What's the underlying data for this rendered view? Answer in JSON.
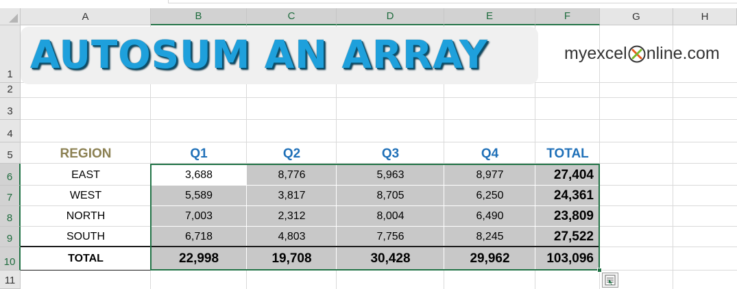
{
  "columns": [
    "A",
    "B",
    "C",
    "D",
    "E",
    "F",
    "G",
    "H"
  ],
  "rows": [
    "1",
    "2",
    "3",
    "4",
    "5",
    "6",
    "7",
    "8",
    "9",
    "10",
    "11"
  ],
  "title": "AUTOSUM AN ARRAY",
  "logo": {
    "prefix": "myexcel",
    "suffix": "nline.com"
  },
  "headers": {
    "region": "REGION",
    "q1": "Q1",
    "q2": "Q2",
    "q3": "Q3",
    "q4": "Q4",
    "total": "TOTAL"
  },
  "table": [
    {
      "region": "EAST",
      "q1": "3,688",
      "q2": "8,776",
      "q3": "5,963",
      "q4": "8,977",
      "total": "27,404"
    },
    {
      "region": "WEST",
      "q1": "5,589",
      "q2": "3,817",
      "q3": "8,705",
      "q4": "6,250",
      "total": "24,361"
    },
    {
      "region": "NORTH",
      "q1": "7,003",
      "q2": "2,312",
      "q3": "8,004",
      "q4": "6,490",
      "total": "23,809"
    },
    {
      "region": "SOUTH",
      "q1": "6,718",
      "q2": "4,803",
      "q3": "7,756",
      "q4": "8,245",
      "total": "27,522"
    }
  ],
  "totals": {
    "label": "TOTAL",
    "q1": "22,998",
    "q2": "19,708",
    "q3": "30,428",
    "q4": "29,962",
    "total": "103,096"
  },
  "colors": {
    "region_header": "#8b8052",
    "quarter_header": "#1f70b8",
    "selection": "#217346",
    "title": "#1ea0dc"
  },
  "icons": [
    "quick-analysis-icon",
    "select-all-triangle-icon",
    "logo-x-icon"
  ]
}
